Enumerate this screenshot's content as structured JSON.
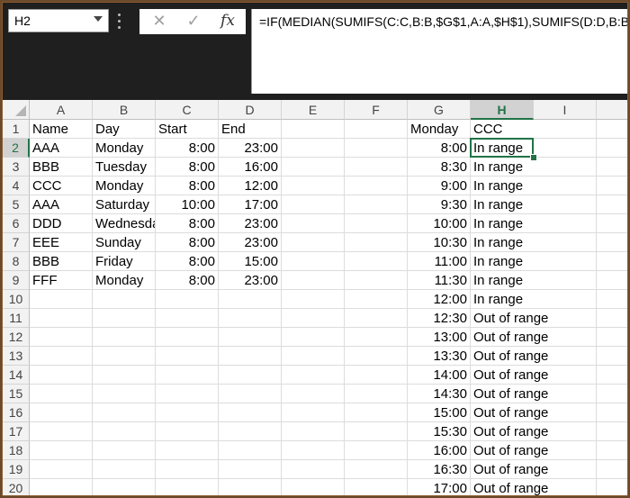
{
  "name_box": "H2",
  "formula_text": "=IF(MEDIAN(SUMIFS(C:C,B:B,$G$1,A:A,$H$1),SUMIFS(D:D,B:B,",
  "formula_buttons": {
    "cancel": "✕",
    "enter": "✓",
    "fx": "fx"
  },
  "icons": {
    "cancel": "close-icon",
    "enter": "check-icon",
    "fx": "function-icon"
  },
  "active_cell": "H2",
  "accent_color": "#217346",
  "columns": [
    "A",
    "B",
    "C",
    "D",
    "E",
    "F",
    "G",
    "H",
    "I"
  ],
  "rows": [
    "1",
    "2",
    "3",
    "4",
    "5",
    "6",
    "7",
    "8",
    "9",
    "10",
    "11",
    "12",
    "13",
    "14",
    "15",
    "16",
    "17",
    "18",
    "19",
    "20"
  ],
  "cells": [
    [
      "Name",
      "Day",
      "Start",
      "End",
      "",
      "",
      "Monday",
      "CCC",
      ""
    ],
    [
      "AAA",
      "Monday",
      "8:00",
      "23:00",
      "",
      "",
      "8:00",
      "In range",
      ""
    ],
    [
      "BBB",
      "Tuesday",
      "8:00",
      "16:00",
      "",
      "",
      "8:30",
      "In range",
      ""
    ],
    [
      "CCC",
      "Monday",
      "8:00",
      "12:00",
      "",
      "",
      "9:00",
      "In range",
      ""
    ],
    [
      "AAA",
      "Saturday",
      "10:00",
      "17:00",
      "",
      "",
      "9:30",
      "In range",
      ""
    ],
    [
      "DDD",
      "Wednesday",
      "8:00",
      "23:00",
      "",
      "",
      "10:00",
      "In range",
      ""
    ],
    [
      "EEE",
      "Sunday",
      "8:00",
      "23:00",
      "",
      "",
      "10:30",
      "In range",
      ""
    ],
    [
      "BBB",
      "Friday",
      "8:00",
      "15:00",
      "",
      "",
      "11:00",
      "In range",
      ""
    ],
    [
      "FFF",
      "Monday",
      "8:00",
      "23:00",
      "",
      "",
      "11:30",
      "In range",
      ""
    ],
    [
      "",
      "",
      "",
      "",
      "",
      "",
      "12:00",
      "In range",
      ""
    ],
    [
      "",
      "",
      "",
      "",
      "",
      "",
      "12:30",
      "Out of range",
      ""
    ],
    [
      "",
      "",
      "",
      "",
      "",
      "",
      "13:00",
      "Out of range",
      ""
    ],
    [
      "",
      "",
      "",
      "",
      "",
      "",
      "13:30",
      "Out of range",
      ""
    ],
    [
      "",
      "",
      "",
      "",
      "",
      "",
      "14:00",
      "Out of range",
      ""
    ],
    [
      "",
      "",
      "",
      "",
      "",
      "",
      "14:30",
      "Out of range",
      ""
    ],
    [
      "",
      "",
      "",
      "",
      "",
      "",
      "15:00",
      "Out of range",
      ""
    ],
    [
      "",
      "",
      "",
      "",
      "",
      "",
      "15:30",
      "Out of range",
      ""
    ],
    [
      "",
      "",
      "",
      "",
      "",
      "",
      "16:00",
      "Out of range",
      ""
    ],
    [
      "",
      "",
      "",
      "",
      "",
      "",
      "16:30",
      "Out of range",
      ""
    ],
    [
      "",
      "",
      "",
      "",
      "",
      "",
      "17:00",
      "Out of range",
      ""
    ]
  ]
}
